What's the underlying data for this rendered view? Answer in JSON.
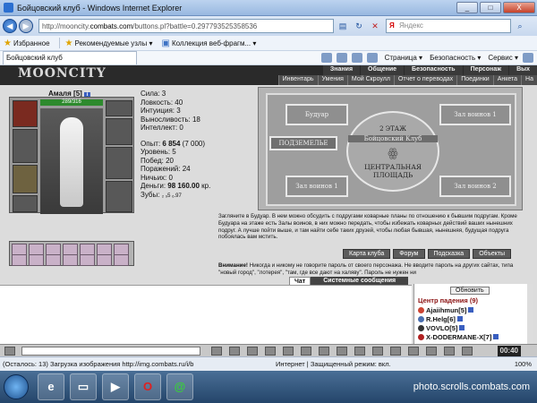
{
  "window": {
    "title": "Бойцовский клуб - Windows Internet Explorer",
    "minimize": "_",
    "maximize": "□",
    "close": "X"
  },
  "address_bar": {
    "url_prefix": "http://mooncity.",
    "url_host": "combats.com",
    "url_rest": "/buttons.pl?battle=0.297793525358536",
    "search_placeholder": "Яндекс"
  },
  "favorites_bar": {
    "favorites": "Избранное",
    "recommended": "Рекомендуемые узлы ▾",
    "gallery": "Коллекция веб-фрагм... ▾"
  },
  "tab_bar": {
    "tab_title": "Бойцовский клуб",
    "page_menu": "Страница ▾",
    "safety_menu": "Безопасность ▾",
    "service_menu": "Сервис ▾"
  },
  "game": {
    "logo": "MOONCITY",
    "main_menu": [
      "Знания",
      "Общение",
      "Безопасность",
      "Персонаж",
      "Вых"
    ],
    "sub_menu": [
      "Инвентарь",
      "Умения",
      "Мой Скроулл",
      "Отчет о переводах",
      "Поединки",
      "Анкета",
      "Ha"
    ],
    "character": {
      "name": "Амаля",
      "level": "[5]",
      "info_badge": "i",
      "hp": "289/316"
    },
    "stats": {
      "strength": "Сила: 3",
      "agility": "Ловкость: 40",
      "intuition": "Интуиция: 3",
      "endurance": "Выносливость: 18",
      "intellect": "Интеллект: 0",
      "experience_label": "Опыт: ",
      "experience_value": "6 854",
      "experience_next": " (7 000)",
      "level": "Уровень: 5",
      "wins": "Побед: 20",
      "losses": "Поражений: 24",
      "draws": "Ничьих: 0",
      "money_label": "Деньги: ",
      "money_value": "98 160.00",
      "money_unit": " кр.",
      "teeth_label": "Зубы: ",
      "teeth_values": "₂ ₉5 ₆.97"
    },
    "map": {
      "room_boudoir": "Будуар",
      "room_warriors_hall1_top": "Зал воинов 1",
      "room_dungeon": "ПОДЗЕМЕЛЬЕ",
      "room_warriors_hall1_bottom": "Зал воинов 1",
      "room_warriors_hall2": "Зал воинов 2",
      "floor_label": "2 ЭТАЖ",
      "club_label": "Бойцовский Клуб",
      "central_square_line1": "ЦЕНТРАЛЬНАЯ",
      "central_square_line2": "ПЛОЩАДЬ"
    },
    "description": "Загляните в Будуар. В нем можно обсудить с подругами коварные планы по отношению к бывшим подругам. Кроме Будуара на этаже есть Залы воинов, в них можно передать, чтобы избежать коварных действий ваших нынешних подруг. А лучше пойти выше, и там найти себе таких друзей, чтобы любая бывшая, нынешняя, будущая подруга побоялась вам мстить.",
    "buttons": {
      "club_map": "Карта клуба",
      "forum": "Форум",
      "hint": "Подсказка",
      "objects": "Объекты"
    },
    "warning_title": "Внимание!",
    "warning_text": " Никогда и никому не говорите пароль от своего персонажа. Не вводите пароль на других сайтах, типа \"новый город\", \"лотерея\", \"там, где все дают на халяву\". Пароль не нужен ни",
    "chat_tabs": {
      "chat": "Чат",
      "system": "Системные сообщения"
    },
    "online": {
      "refresh": "Обновить",
      "title": "Центр падения (9)",
      "players": [
        {
          "name": "Ajaiihmun",
          "level": "[5]"
        },
        {
          "name": "R.Helg",
          "level": "[6]"
        },
        {
          "name": "VOVLO",
          "level": "[5]"
        },
        {
          "name": "X-DODERMANE-X",
          "level": "[7]"
        }
      ]
    },
    "clock": "00:40"
  },
  "status_bar": {
    "loading": "(Осталось: 13) Загрузка изображения http://img.combats.ru/i/b",
    "zone": "Интернет | Защищенный режим: вкл.",
    "zoom": "100%"
  },
  "taskbar": {
    "watermark": "photo.scrolls.combats.com"
  }
}
